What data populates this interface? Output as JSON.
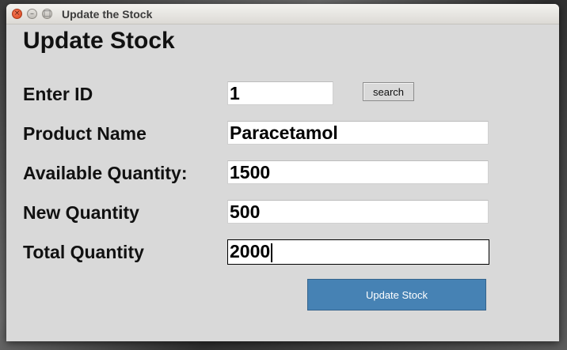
{
  "window": {
    "title": "Update the Stock",
    "close_glyph": "×",
    "min_glyph": "–",
    "max_glyph": "□"
  },
  "form": {
    "heading": "Update Stock",
    "id_label": "Enter ID",
    "id_value": "1",
    "search_label": "search",
    "product_label": "Product Name",
    "product_value": "Paracetamol",
    "available_label": "Available Quantity:",
    "available_value": "1500",
    "new_label": "New Quantity",
    "new_value": "500",
    "total_label": "Total Quantity",
    "total_value": "2000",
    "update_label": "Update Stock"
  },
  "icons": {
    "close": "close-icon",
    "minimize": "minimize-icon",
    "maximize": "maximize-icon"
  },
  "colors": {
    "window_bg": "#d9d9d9",
    "update_button": "#4682b4",
    "entry_bg": "#ffffff"
  }
}
